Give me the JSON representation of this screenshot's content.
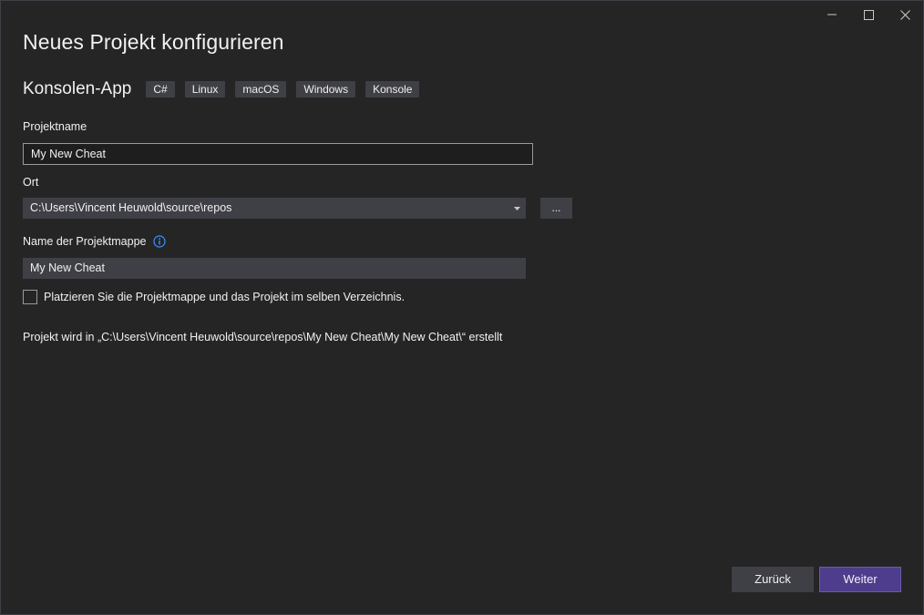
{
  "window": {
    "title": "Neues Projekt konfigurieren",
    "controls": [
      "minimize-icon",
      "maximize-icon",
      "close-icon"
    ]
  },
  "template": {
    "name": "Konsolen-App",
    "tags": [
      "C#",
      "Linux",
      "macOS",
      "Windows",
      "Konsole"
    ]
  },
  "project_name": {
    "label": "Projektname",
    "value": "My New Cheat"
  },
  "location": {
    "label": "Ort",
    "value": "C:\\Users\\Vincent Heuwold\\source\\repos",
    "browse_label": "..."
  },
  "solution_name": {
    "label": "Name der Projektmappe",
    "value": "My New Cheat",
    "info_icon": "info-icon"
  },
  "same_directory": {
    "label": "Platzieren Sie die Projektmappe und das Projekt im selben Verzeichnis.",
    "checked": false
  },
  "path_note": "Projekt wird in „C:\\Users\\Vincent Heuwold\\source\\repos\\My New Cheat\\My New Cheat\\“ erstellt",
  "buttons": {
    "back": "Zurück",
    "next": "Weiter"
  },
  "colors": {
    "background": "#252526",
    "accent": "#4e3c8c",
    "info": "#3794ff"
  }
}
